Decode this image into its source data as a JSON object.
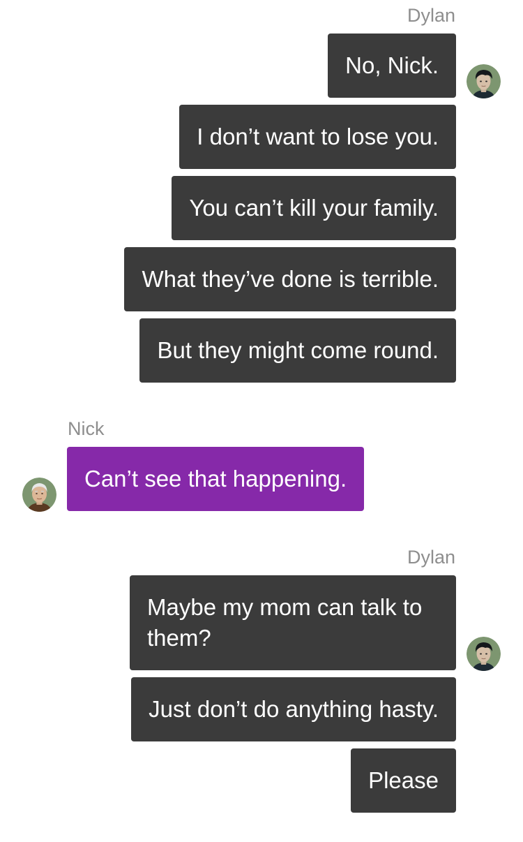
{
  "colors": {
    "outgoing_bubble": "#3b3b3b",
    "incoming_bubble": "#8629a9",
    "sender_name": "#8e8e8e",
    "background": "#ffffff"
  },
  "groups": [
    {
      "sender": "Dylan",
      "side": "right",
      "avatar_icon": "dylan-avatar-icon",
      "messages": [
        "No, Nick.",
        "I don’t want to lose you.",
        "You can’t kill your family.",
        "What they’ve done is terrible.",
        "But they might come round."
      ]
    },
    {
      "sender": "Nick",
      "side": "left",
      "avatar_icon": "nick-avatar-icon",
      "messages": [
        "Can’t see that happening."
      ]
    },
    {
      "sender": "Dylan",
      "side": "right",
      "avatar_icon": "dylan-avatar-icon",
      "messages": [
        "Maybe my mom can talk to them?",
        "Just don’t do anything hasty.",
        "Please"
      ]
    }
  ]
}
